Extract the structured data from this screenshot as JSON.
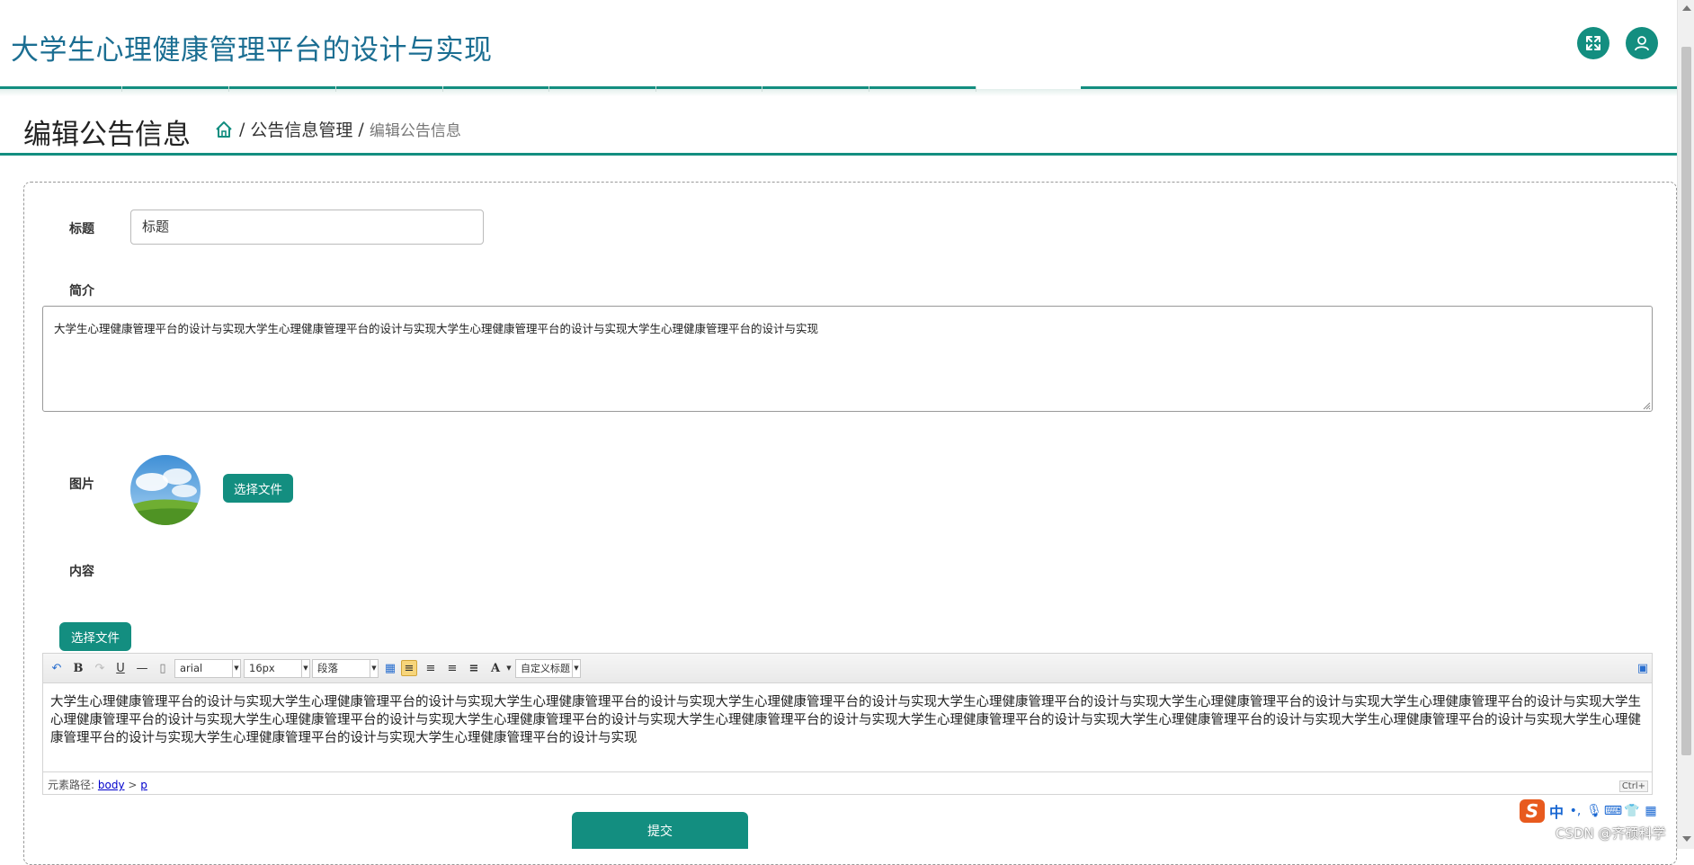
{
  "app": {
    "title": "大学生心理健康管理平台的设计与实现"
  },
  "header": {
    "fullscreen_icon": "expand-icon",
    "user_icon": "user-icon"
  },
  "page": {
    "title": "编辑公告信息",
    "breadcrumb": {
      "home_icon": "home-icon",
      "sep": "/",
      "parent": "公告信息管理",
      "current": "编辑公告信息"
    }
  },
  "form": {
    "title_label": "标题",
    "title_value": "标题",
    "intro_label": "简介",
    "intro_value": "大学生心理健康管理平台的设计与实现大学生心理健康管理平台的设计与实现大学生心理健康管理平台的设计与实现大学生心理健康管理平台的设计与实现",
    "image_label": "图片",
    "image_button": "选择文件",
    "content_label": "内容",
    "content_button": "选择文件",
    "submit": "提交"
  },
  "editor": {
    "font": "arial",
    "size": "16px",
    "paragraph": "段落",
    "custom_title": "自定义标题",
    "content": "大学生心理健康管理平台的设计与实现大学生心理健康管理平台的设计与实现大学生心理健康管理平台的设计与实现大学生心理健康管理平台的设计与实现大学生心理健康管理平台的设计与实现大学生心理健康管理平台的设计与实现大学生心理健康管理平台的设计与实现大学生心理健康管理平台的设计与实现大学生心理健康管理平台的设计与实现大学生心理健康管理平台的设计与实现大学生心理健康管理平台的设计与实现大学生心理健康管理平台的设计与实现大学生心理健康管理平台的设计与实现大学生心理健康管理平台的设计与实现大学生心理健康管理平台的设计与实现大学生心理健康管理平台的设计与实现大学生心理健康管理平台的设计与实现",
    "path_label": "元素路径:",
    "path_body": "body",
    "path_gt": ">",
    "path_p": "p",
    "wordcount": "Ctrl+"
  },
  "ime": {
    "lang": "中",
    "punct": "•,"
  },
  "watermark": "CSDN @齐硕科学",
  "colors": {
    "accent": "#138e80",
    "title_blue": "#1b6e92"
  }
}
